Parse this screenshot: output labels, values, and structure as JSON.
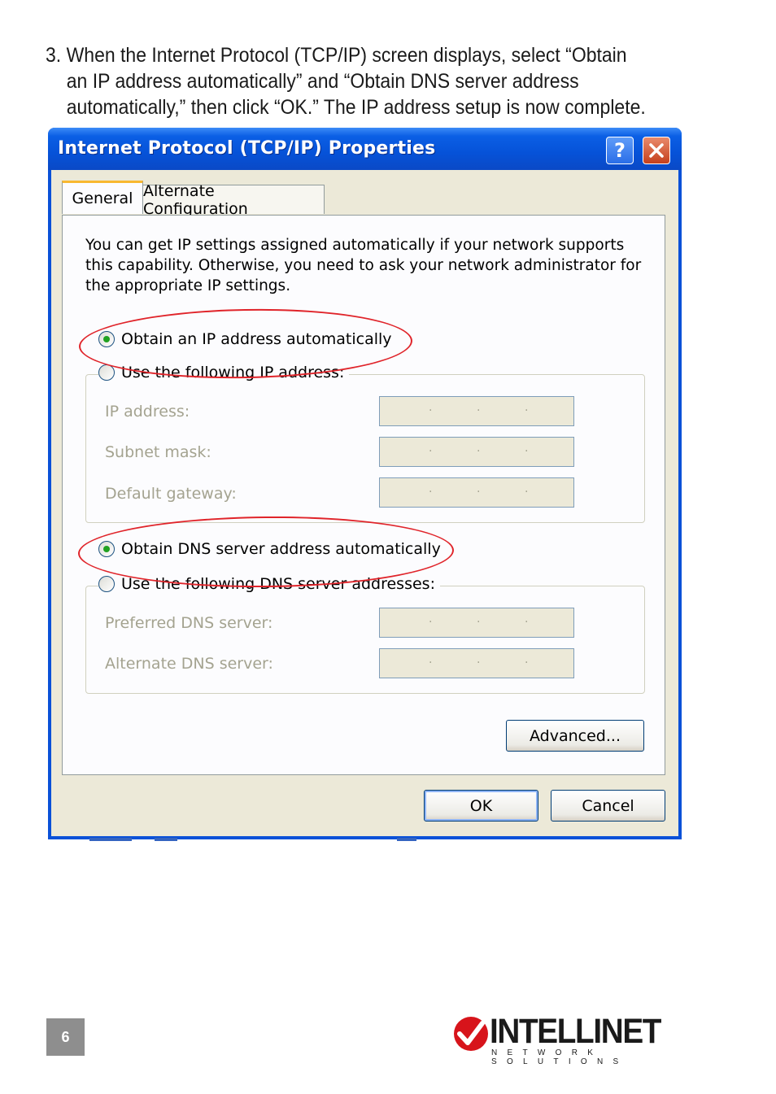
{
  "instructions": {
    "line1": "3. When the Internet Protocol (TCP/IP) screen displays, select “Obtain",
    "line2": "an IP address automatically” and “Obtain DNS server address",
    "line3": "automatically,” then click “OK.” The IP address setup is now complete."
  },
  "dialog": {
    "title": "Internet Protocol (TCP/IP) Properties",
    "help_label": "?",
    "close_label": "✕",
    "tabs": [
      "General",
      "Alternate Configuration"
    ],
    "description_lines": [
      "You can get IP settings assigned automatically if your network supports",
      "this capability. Otherwise, you need to ask your network administrator for",
      "the appropriate IP settings."
    ],
    "ip_section": {
      "obtain_auto": "Obtain an IP address automatically",
      "use_following": "Use the following IP address:",
      "selected": "obtain_auto",
      "fields": [
        "IP address:",
        "Subnet mask:",
        "Default gateway:"
      ]
    },
    "dns_section": {
      "obtain_auto": "Obtain DNS server address automatically",
      "use_following": "Use the following DNS server addresses:",
      "selected": "obtain_auto",
      "fields": [
        "Preferred DNS server:",
        "Alternate DNS server:"
      ]
    },
    "advanced_label": "Advanced...",
    "ok_label": "OK",
    "cancel_label": "Cancel"
  },
  "colors": {
    "titlebar": "#0652d8",
    "highlight_oval": "#e0242a",
    "radio_checked": "#21a121",
    "page_badge": "#8e8e8e",
    "logo_red": "#d7141b"
  },
  "footer": {
    "page_number": "6",
    "brand": "INTELLINET",
    "tagline": "NETWORK SOLUTIONS"
  }
}
